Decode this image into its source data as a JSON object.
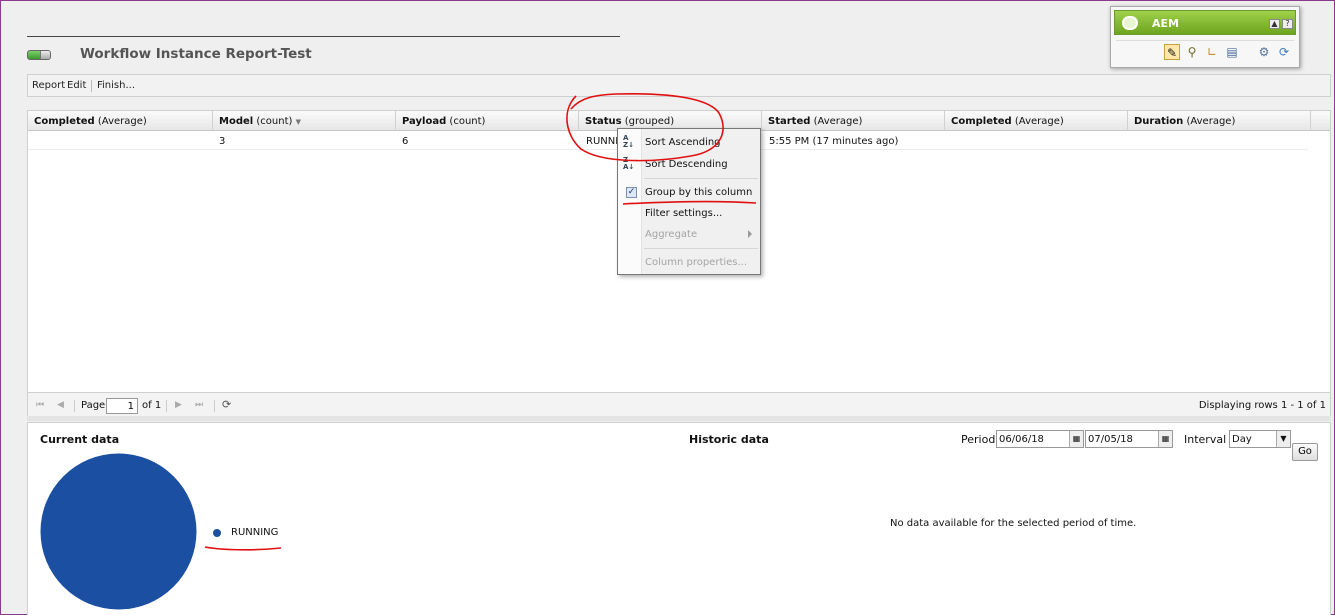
{
  "page": {
    "title": "Workflow Instance Report-Test"
  },
  "sidekick": {
    "title": "AEM",
    "min_btn": "▲",
    "help_btn": "?"
  },
  "toolbar": {
    "report": "Report",
    "edit": "Edit",
    "finish": "Finish..."
  },
  "grid": {
    "columns": [
      {
        "name": "Completed",
        "qualifier": "(Average)"
      },
      {
        "name": "Model",
        "qualifier": "(count)"
      },
      {
        "name": "Payload",
        "qualifier": "(count)"
      },
      {
        "name": "Status",
        "qualifier": "(grouped)"
      },
      {
        "name": "Started",
        "qualifier": "(Average)"
      },
      {
        "name": "Completed",
        "qualifier": "(Average)"
      },
      {
        "name": "Duration",
        "qualifier": "(Average)"
      }
    ],
    "rows": [
      {
        "completed": "",
        "model": "3",
        "payload": "6",
        "status": "RUNNI",
        "started": "5:55 PM (17 minutes ago)",
        "completed2": "",
        "duration": ""
      }
    ]
  },
  "pager": {
    "page_label": "Page",
    "page_value": "1",
    "of_label": "of 1",
    "status": "Displaying rows 1 - 1 of 1"
  },
  "column_menu": {
    "sort_asc": "Sort Ascending",
    "sort_desc": "Sort Descending",
    "group_by": "Group by this column",
    "filter": "Filter settings...",
    "aggregate": "Aggregate",
    "column_props": "Column properties..."
  },
  "current_data": {
    "title": "Current data",
    "legend": "RUNNING",
    "colors": {
      "running": "#1a4fa2"
    }
  },
  "historic_data": {
    "title": "Historic data",
    "period_label": "Period",
    "period_from": "06/06/18",
    "period_to": "07/05/18",
    "interval_label": "Interval",
    "interval_value": "Day",
    "go_label": "Go",
    "empty_message": "No data available for the selected period of time."
  },
  "chart_data": {
    "type": "pie",
    "categories": [
      "RUNNING"
    ],
    "values": [
      1
    ],
    "title": "Current data"
  }
}
